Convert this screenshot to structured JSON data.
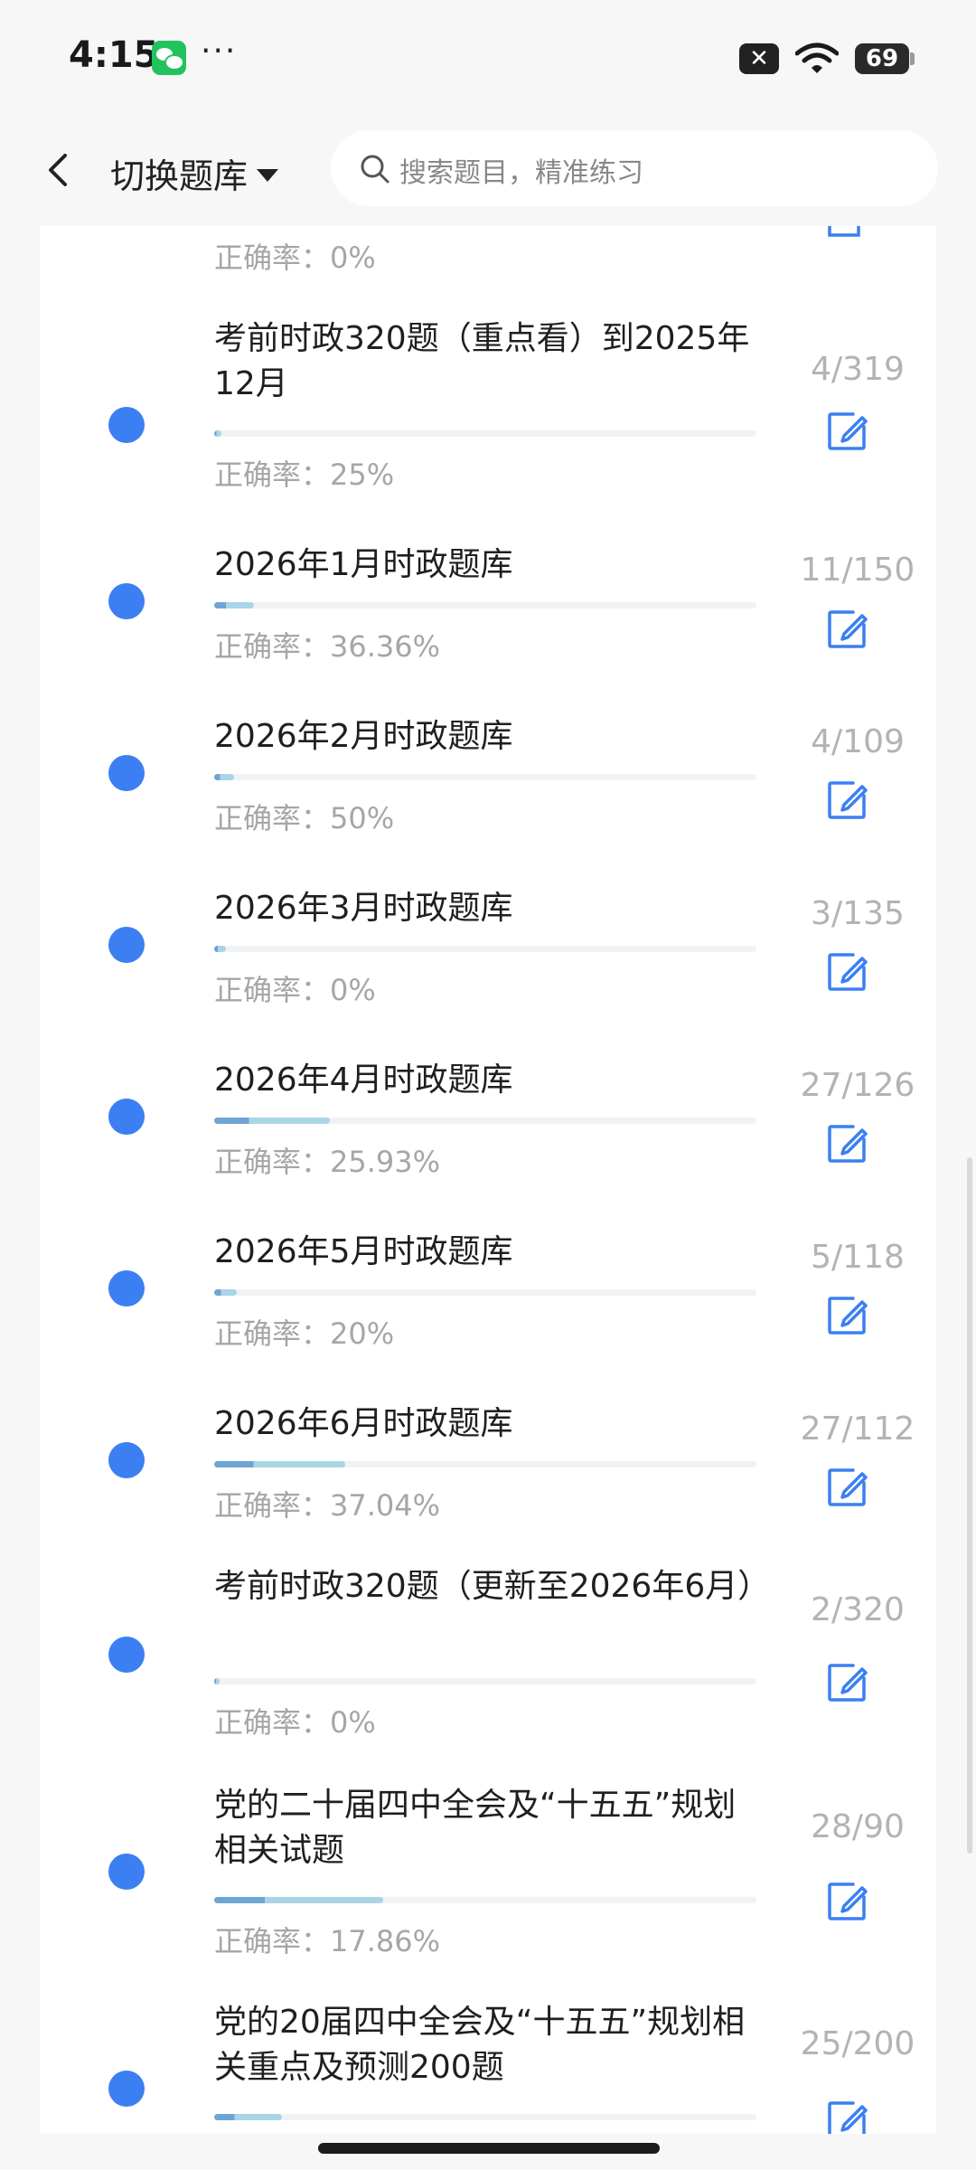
{
  "status_bar": {
    "time": "4:15",
    "more": "···",
    "notif": "✕",
    "battery": "69"
  },
  "header": {
    "switch_label": "切换题库",
    "search_placeholder": "搜索题目，精准练习"
  },
  "top_partial": {
    "accuracy": "正确率：0%"
  },
  "items": [
    {
      "title": "考前时政320题（重点看）到2025年12月",
      "count": "4/319",
      "accuracy": "正确率：25%",
      "progress": 0.0125
    },
    {
      "title": "2026年1月时政题库",
      "count": "11/150",
      "accuracy": "正确率：36.36%",
      "progress": 0.073
    },
    {
      "title": "2026年2月时政题库",
      "count": "4/109",
      "accuracy": "正确率：50%",
      "progress": 0.037
    },
    {
      "title": "2026年3月时政题库",
      "count": "3/135",
      "accuracy": "正确率：0%",
      "progress": 0.022
    },
    {
      "title": "2026年4月时政题库",
      "count": "27/126",
      "accuracy": "正确率：25.93%",
      "progress": 0.214
    },
    {
      "title": "2026年5月时政题库",
      "count": "5/118",
      "accuracy": "正确率：20%",
      "progress": 0.042
    },
    {
      "title": "2026年6月时政题库",
      "count": "27/112",
      "accuracy": "正确率：37.04%",
      "progress": 0.241
    },
    {
      "title": "考前时政320题（更新至2026年6月）",
      "count": "2/320",
      "accuracy": "正确率：0%",
      "progress": 0.006
    },
    {
      "title": "党的二十届四中全会及“十五五”规划相关试题",
      "count": "28/90",
      "accuracy": "正确率：17.86%",
      "progress": 0.311
    },
    {
      "title": "党的20届四中全会及“十五五”规划相关重点及预测200题",
      "count": "25/200",
      "accuracy": "",
      "progress": 0.125
    }
  ],
  "colors": {
    "accent": "#3b7ff2",
    "fill_dark": "#6fa5d2",
    "fill_light": "#a9d5e6",
    "muted": "#a6a6a6"
  }
}
